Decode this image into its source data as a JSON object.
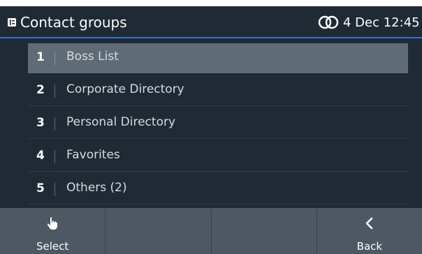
{
  "header": {
    "title": "Contact groups",
    "datetime": "4 Dec 12:45",
    "icon": "phonebook-icon",
    "status_icon": "rings-icon"
  },
  "list": {
    "items": [
      {
        "number": "1",
        "label": "Boss List",
        "selected": true
      },
      {
        "number": "2",
        "label": "Corporate Directory",
        "selected": false
      },
      {
        "number": "3",
        "label": "Personal Directory",
        "selected": false
      },
      {
        "number": "4",
        "label": "Favorites",
        "selected": false
      },
      {
        "number": "5",
        "label": "Others (2)",
        "selected": false
      }
    ]
  },
  "softkeys": {
    "select_label": "Select",
    "select_icon": "hand-pointer-icon",
    "back_label": "Back",
    "back_icon": "chevron-left-icon"
  },
  "colors": {
    "background": "#1f2a34",
    "header_underline": "#3a78b8",
    "selected_row": "#5f6b75",
    "softkey_bar": "#4d5862"
  }
}
